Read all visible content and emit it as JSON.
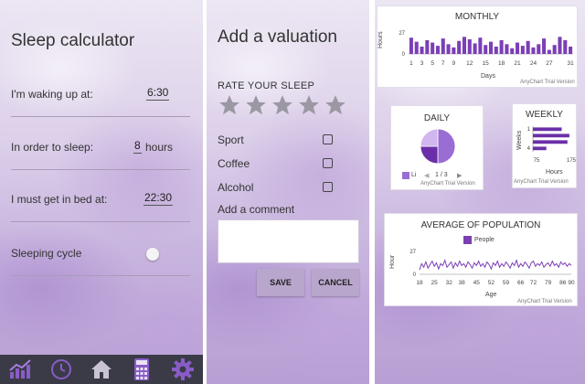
{
  "calculator": {
    "title": "Sleep calculator",
    "wake_label": "I'm waking up at:",
    "wake_value": "6:30",
    "sleep_label": "In order to sleep:",
    "sleep_value": "8",
    "sleep_unit": "hours",
    "bed_label": "I must get in bed at:",
    "bed_value": "22:30",
    "cycle_label": "Sleeping cycle",
    "cycle_enabled": false,
    "nav_icons": [
      "chart-icon",
      "clock-icon",
      "home-icon",
      "calculator-icon",
      "gear-icon"
    ],
    "accent": "#7d4fbf",
    "nav_bg": "#3a3b47"
  },
  "valuation": {
    "title": "Add a valuation",
    "rate_label": "RATE YOUR SLEEP",
    "stars_selected": 0,
    "stars_total": 5,
    "options": [
      "Sport",
      "Coffee",
      "Alcohol"
    ],
    "comment_label": "Add a comment",
    "save_label": "SAVE",
    "cancel_label": "CANCEL"
  },
  "stats": {
    "credit": "AnyChart Trial Version",
    "pager": "1 / 3",
    "pie_legend": "Li"
  },
  "chart_data": [
    {
      "type": "bar",
      "title": "MONTHLY",
      "xlabel": "Days",
      "ylabel": "Hours",
      "ylim": [
        0,
        27
      ],
      "yticks": [
        "27",
        "0"
      ],
      "xticks": [
        "1",
        "3",
        "5",
        "7",
        "9",
        "12",
        "15",
        "18",
        "21",
        "24",
        "27",
        "31"
      ],
      "x": [
        1,
        2,
        3,
        4,
        5,
        6,
        7,
        8,
        9,
        10,
        11,
        12,
        13,
        14,
        15,
        16,
        17,
        18,
        19,
        20,
        21,
        22,
        23,
        24,
        25,
        26,
        27,
        28,
        29,
        30,
        31
      ],
      "values": [
        20,
        15,
        9,
        17,
        14,
        10,
        19,
        12,
        8,
        16,
        21,
        18,
        13,
        20,
        11,
        15,
        9,
        17,
        12,
        7,
        14,
        10,
        16,
        8,
        12,
        19,
        5,
        11,
        21,
        17,
        9
      ],
      "color": "#7b3fb5"
    },
    {
      "type": "pie",
      "title": "DAILY",
      "values": [
        50,
        25,
        25
      ],
      "colors": [
        "#9a6dd4",
        "#6a2fa8",
        "#d1b6ef"
      ]
    },
    {
      "type": "bar",
      "orientation": "horizontal",
      "title": "WEEKLY",
      "xlabel": "Hours",
      "ylabel": "Weeks",
      "xlim": [
        75,
        175
      ],
      "xticks": [
        "75",
        "175"
      ],
      "yticks": [
        "1",
        "4"
      ],
      "categories": [
        1,
        2,
        3,
        4
      ],
      "values": [
        150,
        170,
        165,
        110
      ],
      "color": "#6a2fa8"
    },
    {
      "type": "line",
      "title": "AVERAGE OF POPULATION",
      "xlabel": "Age",
      "ylabel": "Hour",
      "ylim": [
        0,
        27
      ],
      "yticks": [
        "27",
        "0"
      ],
      "xticks": [
        "18",
        "25",
        "32",
        "38",
        "45",
        "52",
        "59",
        "66",
        "72",
        "79",
        "86",
        "90"
      ],
      "series": [
        {
          "name": "People",
          "x": [
            18,
            19,
            20,
            21,
            22,
            23,
            24,
            25,
            26,
            27,
            28,
            29,
            30,
            31,
            32,
            33,
            34,
            35,
            36,
            37,
            38,
            39,
            40,
            41,
            42,
            43,
            44,
            45,
            46,
            47,
            48,
            49,
            50,
            51,
            52,
            53,
            54,
            55,
            56,
            57,
            58,
            59,
            60,
            61,
            62,
            63,
            64,
            65,
            66,
            67,
            68,
            69,
            70,
            71,
            72,
            73,
            74,
            75,
            76,
            77,
            78,
            79,
            80,
            81,
            82,
            83,
            84,
            85,
            86,
            87,
            88,
            89,
            90
          ],
          "values": [
            5,
            12,
            8,
            14,
            7,
            11,
            15,
            9,
            13,
            6,
            12,
            10,
            16,
            8,
            11,
            14,
            7,
            13,
            9,
            15,
            10,
            12,
            8,
            14,
            11,
            7,
            13,
            10,
            15,
            9,
            12,
            8,
            14,
            11,
            6,
            13,
            10,
            15,
            8,
            12,
            9,
            14,
            11,
            7,
            13,
            10,
            16,
            8,
            12,
            9,
            14,
            11,
            7,
            13,
            15,
            9,
            12,
            10,
            14,
            8,
            11,
            13,
            9,
            15,
            10,
            12,
            8,
            14,
            11,
            13,
            9,
            12,
            10
          ],
          "color": "#7b3fb5"
        }
      ]
    }
  ]
}
